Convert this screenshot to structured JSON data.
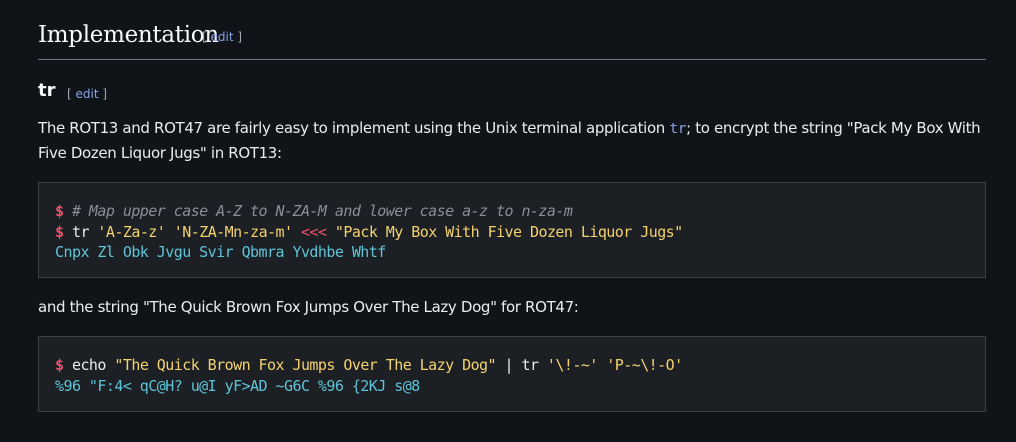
{
  "section": {
    "title": "Implementation",
    "edit_open": "[ ",
    "edit_label": "edit",
    "edit_close": " ]"
  },
  "subsection": {
    "title": "tr",
    "edit_open": "[ ",
    "edit_label": "edit",
    "edit_close": " ]"
  },
  "para1": {
    "before": "The ROT13 and ROT47 are fairly easy to implement using the Unix terminal application ",
    "code": "tr",
    "after": "; to encrypt the string \"Pack My Box With Five Dozen Liquor Jugs\" in ROT13:"
  },
  "code1": {
    "line1_prompt": "$",
    "line1_comment": " # Map upper case A-Z to N-ZA-M and lower case a-z to n-za-m",
    "line2_prompt": "$",
    "line2_cmd": " tr ",
    "line2_arg1": "'A-Za-z'",
    "line2_sp1": " ",
    "line2_arg2": "'N-ZA-Mn-za-m'",
    "line2_sp2": " ",
    "line2_op": "<<<",
    "line2_sp3": " ",
    "line2_str": "\"Pack My Box With Five Dozen Liquor Jugs\"",
    "line3_out": "Cnpx Zl Obk Jvgu Svir Qbmra Yvdhbe Whtf"
  },
  "para2": {
    "text": "and the string \"The Quick Brown Fox Jumps Over The Lazy Dog\" for ROT47:"
  },
  "code2": {
    "line1_prompt": "$",
    "line1_cmd": " echo ",
    "line1_str": "\"The Quick Brown Fox Jumps Over The Lazy Dog\"",
    "line1_pipe": " | tr ",
    "line1_arg1": "'\\!-~'",
    "line1_sp": " ",
    "line1_arg2": "'P-~\\!-O'",
    "line2_out": "%96 \"F:4< qC@H? u@I yF>AD ~G6C %96 {2KJ s@8"
  }
}
